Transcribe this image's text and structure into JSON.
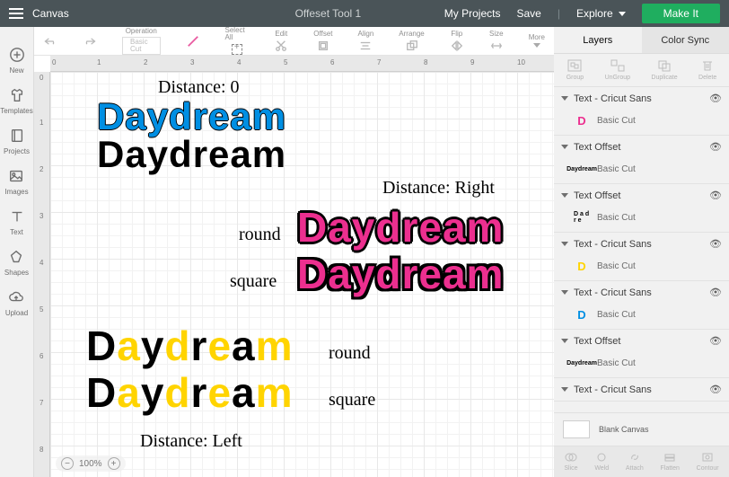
{
  "topbar": {
    "title_left": "Canvas",
    "title_center": "Offeset Tool 1",
    "my_projects": "My Projects",
    "save": "Save",
    "explore": "Explore",
    "make_it": "Make It"
  },
  "left_tools": {
    "new": "New",
    "templates": "Templates",
    "projects": "Projects",
    "images": "Images",
    "text": "Text",
    "shapes": "Shapes",
    "upload": "Upload"
  },
  "editbar": {
    "operation": "Operation",
    "operation_val": "Basic Cut",
    "select_all": "Select All",
    "edit": "Edit",
    "offset": "Offset",
    "align": "Align",
    "arrange": "Arrange",
    "flip": "Flip",
    "size": "Size",
    "more": "More"
  },
  "ruler_h": [
    "0",
    "1",
    "2",
    "3",
    "4",
    "5",
    "6",
    "7",
    "8",
    "9",
    "10"
  ],
  "ruler_v": [
    "0",
    "1",
    "2",
    "3",
    "4",
    "5",
    "6",
    "7",
    "8"
  ],
  "canvas": {
    "label_dist0": "Distance: 0",
    "label_distR": "Distance: Right",
    "label_distL": "Distance: Left",
    "label_round1": "round",
    "label_square1": "square",
    "label_round2": "round",
    "label_square2": "square",
    "word": "Daydream",
    "zoom": "100%"
  },
  "right": {
    "tab_layers": "Layers",
    "tab_color": "Color Sync",
    "ops": {
      "group": "Group",
      "ungroup": "UnGroup",
      "duplicate": "Duplicate",
      "delete": "Delete"
    },
    "basic_cut": "Basic Cut",
    "layers": [
      {
        "title": "Text - Cricut Sans",
        "swatch": "pink",
        "swtext": "D"
      },
      {
        "title": "Text Offset",
        "swatch": "thumb",
        "swtext": "Daydream"
      },
      {
        "title": "Text Offset",
        "swatch": "thumb",
        "swtext": "D a d r e"
      },
      {
        "title": "Text - Cricut Sans",
        "swatch": "yellow",
        "swtext": "D"
      },
      {
        "title": "Text - Cricut Sans",
        "swatch": "blue",
        "swtext": "D"
      },
      {
        "title": "Text Offset",
        "swatch": "thumb",
        "swtext": "Daydream"
      },
      {
        "title": "Text - Cricut Sans",
        "swatch": "",
        "swtext": ""
      }
    ],
    "blank": "Blank Canvas",
    "bottom": {
      "slice": "Slice",
      "weld": "Weld",
      "attach": "Attach",
      "flatten": "Flatten",
      "contour": "Contour"
    }
  }
}
